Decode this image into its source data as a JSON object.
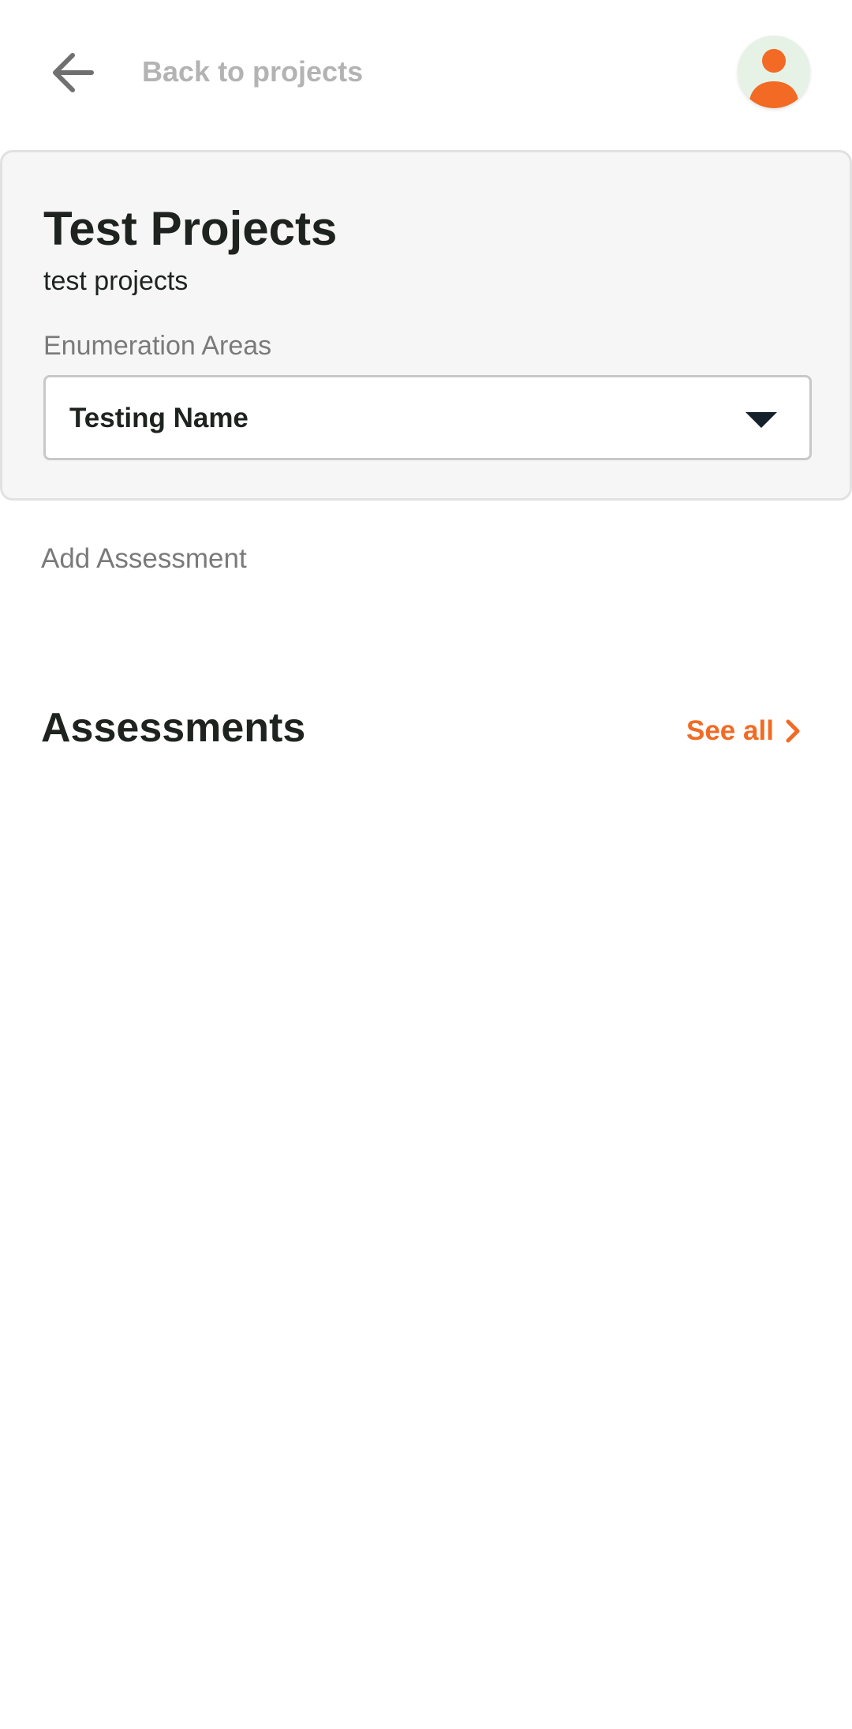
{
  "header": {
    "back_label": "Back to projects",
    "back_icon": "arrow-left-icon",
    "avatar_icon": "user-avatar-icon"
  },
  "project": {
    "title": "Test Projects",
    "subtitle": "test projects",
    "enumeration_label": "Enumeration Areas",
    "enumeration_selected": "Testing Name",
    "dropdown_icon": "caret-down-icon"
  },
  "actions": {
    "add_assessment": "Add Assessment"
  },
  "assessments": {
    "title": "Assessments",
    "see_all": "See all",
    "see_all_icon": "chevron-right-icon"
  },
  "colors": {
    "accent": "#f26a24",
    "text": "#1f2320",
    "muted": "#7a7a7a",
    "card_bg": "#f6f6f6",
    "avatar_bg": "#e6f2e6"
  }
}
